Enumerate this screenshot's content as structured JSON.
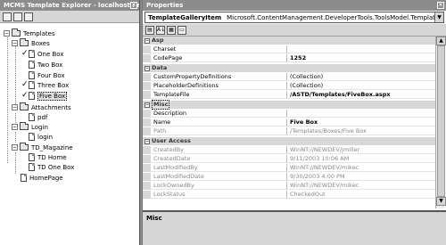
{
  "explorer": {
    "title": "MCMS Template Explorer - localhost : mikec",
    "close_glyph": "×",
    "tree": {
      "templates": "Templates",
      "boxes": "Boxes",
      "one_box": "One Box",
      "two_box": "Two Box",
      "four_box": "Four Box",
      "three_box": "Three Box",
      "five_box": "Five Box",
      "attachments": "Attachments",
      "pdf": "pdf",
      "login_folder": "Login",
      "login_item": "login",
      "td_magazine": "TD_Magazine",
      "td_home": "TD Home",
      "td_one_box": "TD One Box",
      "homepage": "HomePage"
    }
  },
  "properties": {
    "title": "Properties",
    "close_glyph": "×",
    "selector": {
      "name": "TemplateGalleryItem",
      "type": "Microsoft.ContentManagement.DeveloperTools.ToolsModel.TemplateGalleryItem"
    },
    "categories": {
      "asp": "Asp",
      "data": "Data",
      "misc": "Misc",
      "user_access": "User Access"
    },
    "rows": {
      "charset": {
        "name": "Charset",
        "value": ""
      },
      "codepage": {
        "name": "CodePage",
        "value": "1252"
      },
      "custom_props": {
        "name": "CustomPropertyDefinitions",
        "value": "(Collection)"
      },
      "placeholder_defs": {
        "name": "PlaceholderDefinitions",
        "value": "(Collection)"
      },
      "template_file": {
        "name": "TemplateFile",
        "value": "/ASTD/Templates/FiveBox.aspx"
      },
      "description": {
        "name": "Description",
        "value": ""
      },
      "name": {
        "name": "Name",
        "value": "Five Box"
      },
      "path": {
        "name": "Path",
        "value": "/Templates/Boxes/Five Box"
      },
      "created_by": {
        "name": "CreatedBy",
        "value": "WinNT://NEWDEV/jmiller"
      },
      "created_date": {
        "name": "CreatedDate",
        "value": "9/11/2003 10:06 AM"
      },
      "last_modified_by": {
        "name": "LastModifiedBy",
        "value": "WinNT://NEWDEV/mikec"
      },
      "last_modified_date": {
        "name": "LastModifiedDate",
        "value": "9/30/2003 4:00 PM"
      },
      "lock_owned_by": {
        "name": "LockOwnedBy",
        "value": "WinNT://NEWDEV/mikec"
      },
      "lock_status": {
        "name": "LockStatus",
        "value": "CheckedOut"
      }
    },
    "description_pane": "Misc"
  }
}
